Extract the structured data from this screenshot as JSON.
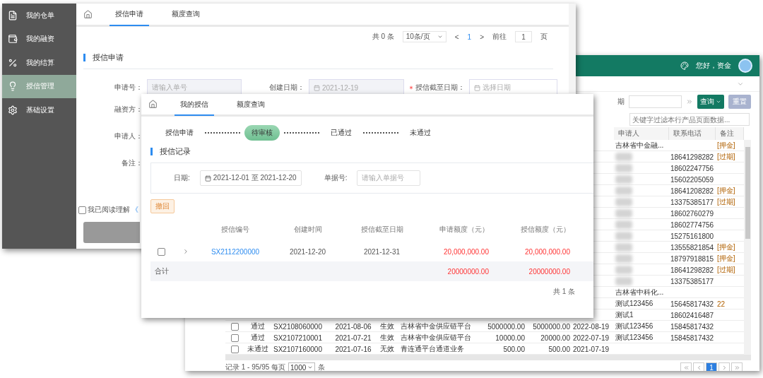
{
  "records_window": {
    "greeting": "您好，资金",
    "toolbar": {
      "date_label": "期",
      "query_button": "查询",
      "reset_button": "重置",
      "filter_placeholder": "关键字过滤本行产品页面数据..."
    },
    "columns": [
      "申请人",
      "联系电话",
      "备注"
    ],
    "rows": [
      {
        "applicant": "吉林省中金融...",
        "note": "[押金]"
      },
      {
        "blurred": true,
        "phone": "18641298282",
        "note": "[过期]"
      },
      {
        "blurred": true,
        "phone": "18602247756"
      },
      {
        "blurred": true,
        "phone": "15602205059"
      },
      {
        "blurred": true,
        "phone": "18641208282",
        "note": "[押金]"
      },
      {
        "blurred": true,
        "phone": "13375385177",
        "note": "[过期]"
      },
      {
        "blurred": true,
        "phone": "18602760279"
      },
      {
        "blurred": true,
        "phone": "18602774756"
      },
      {
        "blurred": true,
        "phone": "15275161800"
      },
      {
        "blurred": true,
        "phone": "13555821854",
        "note": "[押金]"
      },
      {
        "blurred": true,
        "phone": "18797918815",
        "note": "[押金]"
      },
      {
        "blurred": true,
        "phone": "18641298282",
        "note": "[过期]"
      },
      {
        "blurred": true,
        "phone": "13375385177"
      },
      {
        "applicant": "吉林省中科化..."
      },
      {
        "applicant": "测试123456",
        "phone": "15645817432",
        "note": "22"
      },
      {
        "applicant": "测试1",
        "phone": "18602416487"
      },
      {
        "checked": false,
        "status": "通过",
        "code": "SX2108060000",
        "date": "2021-08-06",
        "state": "生效",
        "company": "吉林省中金供应链平台",
        "amount": "5000000.00",
        "granted": "5000000.00",
        "end_date": "2022-08-19",
        "applicant": "测试123456",
        "phone": "15845817432"
      },
      {
        "checked": false,
        "status": "通过",
        "code": "SX2107210001",
        "date": "2021-07-21",
        "state": "生效",
        "company": "吉林省中金供应链平台",
        "amount": "10000.00",
        "granted": "20000.00",
        "end_date": "2022-07-19",
        "applicant": "测试123456",
        "phone": "15845817432"
      },
      {
        "checked": false,
        "status": "未通过",
        "code": "SX2107160000",
        "date": "2021-07-16",
        "state": "无效",
        "company": "青连通平台通道业务",
        "amount": "500.00",
        "granted": "500.00",
        "end_date": "2021-07-19"
      }
    ],
    "footer": {
      "records": "记录 1 - 95/95 每页",
      "page_size": "1000",
      "unit": "条"
    },
    "pages": [
      {
        "label": "1",
        "selected": true
      }
    ]
  },
  "apply_window": {
    "sidebar": [
      {
        "label": "我的仓单",
        "selected": false
      },
      {
        "label": "我的融资",
        "selected": false
      },
      {
        "label": "我的结算",
        "selected": false
      },
      {
        "label": "授信管理",
        "selected": true
      },
      {
        "label": "基础设置",
        "selected": false
      }
    ],
    "tabs": [
      {
        "label": "授信申请",
        "selected": true
      },
      {
        "label": "额度查询",
        "selected": false
      }
    ],
    "pagination": {
      "total": "共 0 条",
      "page_size": "10条/页",
      "prev": "<",
      "page": "1",
      "next": ">",
      "goto_label": "前往",
      "goto_value": "1",
      "unit": "页"
    },
    "section_title": "授信申请",
    "fields": [
      {
        "label": "申请号：",
        "placeholder": "请输入单号",
        "disabled": true,
        "required": false
      },
      {
        "label": "创建日期：",
        "value": "2021-12-19",
        "disabled": true,
        "required": false
      },
      {
        "label": "授信截至日期：",
        "placeholder": "选择日期",
        "disabled": false,
        "required": true
      }
    ],
    "labels": [
      "融资方：",
      "申请人：",
      "备注："
    ],
    "agreement": {
      "checked": false,
      "text": "我已阅读理解",
      "link": "《"
    }
  },
  "credit_window": {
    "tabs": [
      {
        "label": "我的授信",
        "selected": true
      },
      {
        "label": "额度查询",
        "selected": false
      }
    ],
    "steps": [
      {
        "label": "授信申请",
        "selected": false
      },
      {
        "label": "待审核",
        "selected": true
      },
      {
        "label": "已通过",
        "selected": false
      },
      {
        "label": "未通过",
        "selected": false
      }
    ],
    "section_title": "授信记录",
    "filters": {
      "date_label": "日期:",
      "date_range": "2021-12-01 至 2021-12-20",
      "doc_label": "单据号:",
      "doc_placeholder": "请输入单据号"
    },
    "withdraw_button": "撤回",
    "columns": [
      "授信编号",
      "创建时间",
      "授信截至日期",
      "申请额度（元）",
      "授信额度（元）"
    ],
    "rows": [
      {
        "checked": false,
        "id": "SX2112200000",
        "created": "2021-12-20",
        "deadline": "2021-12-31",
        "applied": "20,000,000.00",
        "granted": "20,000,000.00"
      }
    ],
    "total": {
      "label": "合计",
      "applied": "20000000.00",
      "granted": "20000000.00"
    },
    "count": "共 1 条"
  }
}
